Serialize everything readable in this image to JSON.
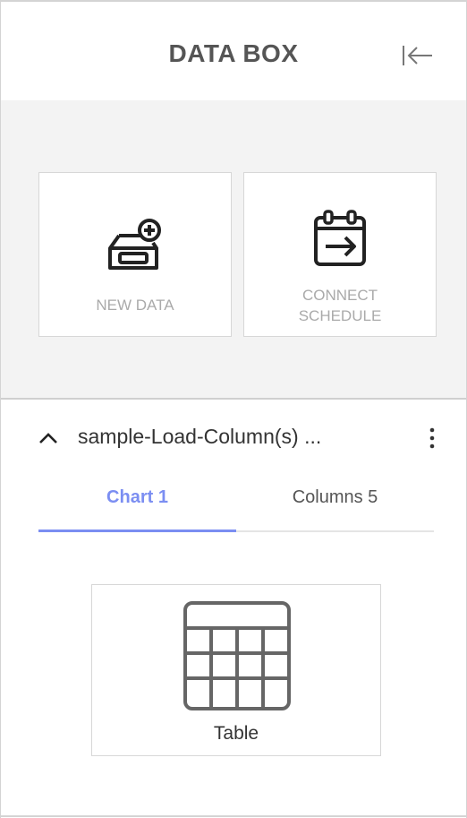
{
  "header": {
    "title": "DATA BOX",
    "collapse_icon": "collapse-left-icon"
  },
  "actions": {
    "new_data": {
      "label": "NEW DATA",
      "icon": "new-data-icon"
    },
    "connect_schedule": {
      "label_line1": "CONNECT",
      "label_line2": "SCHEDULE",
      "icon": "calendar-arrow-icon"
    }
  },
  "dataset": {
    "name": "sample-Load-Column(s) ...",
    "expand_icon": "chevron-up-icon",
    "menu_icon": "more-vertical-icon"
  },
  "tabs": [
    {
      "label": "Chart 1",
      "active": true
    },
    {
      "label": "Columns 5",
      "active": false
    }
  ],
  "charts": [
    {
      "label": "Table",
      "icon": "table-icon"
    }
  ],
  "colors": {
    "accent": "#7b8ef2",
    "title": "#555555",
    "muted_label": "#aaaaaa",
    "action_bg": "#f3f3f3"
  }
}
